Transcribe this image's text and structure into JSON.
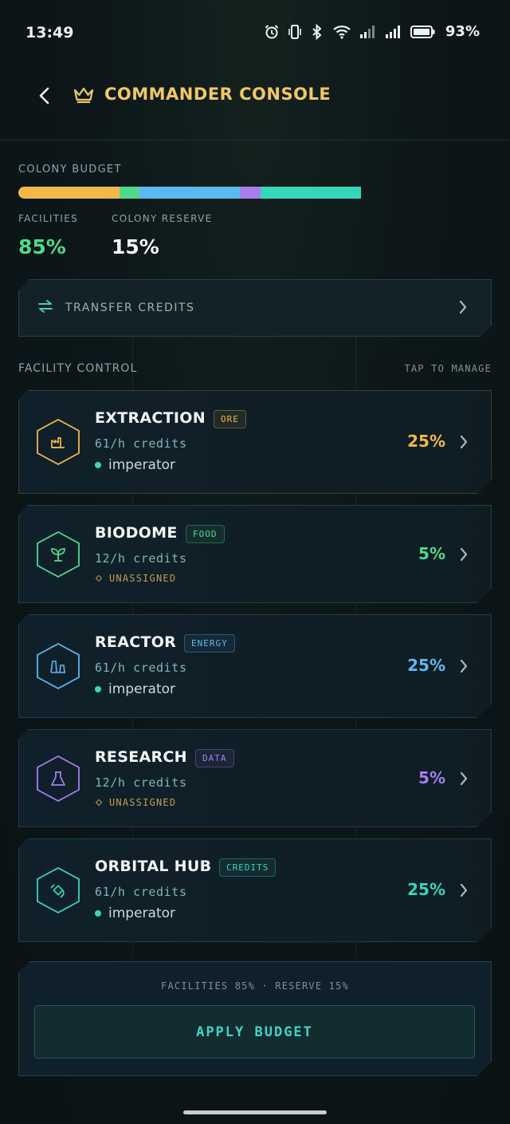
{
  "status_bar": {
    "time": "13:49",
    "battery": "93%",
    "icons": [
      "alarm-icon",
      "vibrate-icon",
      "bluetooth-icon",
      "wifi-icon",
      "signal-icon",
      "signal-icon",
      "battery-icon"
    ]
  },
  "header": {
    "title": "COMMANDER CONSOLE",
    "icon": "crown-icon"
  },
  "budget": {
    "label": "COLONY BUDGET",
    "segments": [
      {
        "name": "EXTRACTION",
        "percent": 25,
        "color": "#f2b84a"
      },
      {
        "name": "BIODOME",
        "percent": 5,
        "color": "#4fd98a"
      },
      {
        "name": "REACTOR",
        "percent": 25,
        "color": "#5bb8f0"
      },
      {
        "name": "RESEARCH",
        "percent": 5,
        "color": "#a67ef0"
      },
      {
        "name": "ORBITAL HUB",
        "percent": 25,
        "color": "#36d6b8"
      }
    ],
    "facilities_label": "FACILITIES",
    "facilities_value": "85%",
    "reserve_label": "COLONY RESERVE",
    "reserve_value": "15%"
  },
  "transfer": {
    "label": "TRANSFER CREDITS"
  },
  "section": {
    "title": "FACILITY CONTROL",
    "hint": "TAP TO MANAGE"
  },
  "facilities": [
    {
      "name": "EXTRACTION",
      "tag": "ORE",
      "rate": "61/h credits",
      "owner": "imperator",
      "percent": "25%",
      "color": "#f2b84a",
      "icon": "factory-icon",
      "assigned": true
    },
    {
      "name": "BIODOME",
      "tag": "FOOD",
      "rate": "12/h credits",
      "owner": "UNASSIGNED",
      "percent": "5%",
      "color": "#4fd98a",
      "icon": "sprout-icon",
      "assigned": false
    },
    {
      "name": "REACTOR",
      "tag": "ENERGY",
      "rate": "61/h credits",
      "owner": "imperator",
      "percent": "25%",
      "color": "#5bb8f0",
      "icon": "power-plant-icon",
      "assigned": true
    },
    {
      "name": "RESEARCH",
      "tag": "DATA",
      "rate": "12/h credits",
      "owner": "UNASSIGNED",
      "percent": "5%",
      "color": "#a67ef0",
      "icon": "flask-icon",
      "assigned": false
    },
    {
      "name": "ORBITAL HUB",
      "tag": "CREDITS",
      "rate": "61/h credits",
      "owner": "imperator",
      "percent": "25%",
      "color": "#36d6b8",
      "icon": "satellite-icon",
      "assigned": true
    }
  ],
  "footer": {
    "summary": "FACILITIES 85% · RESERVE 15%",
    "apply_label": "APPLY BUDGET"
  }
}
